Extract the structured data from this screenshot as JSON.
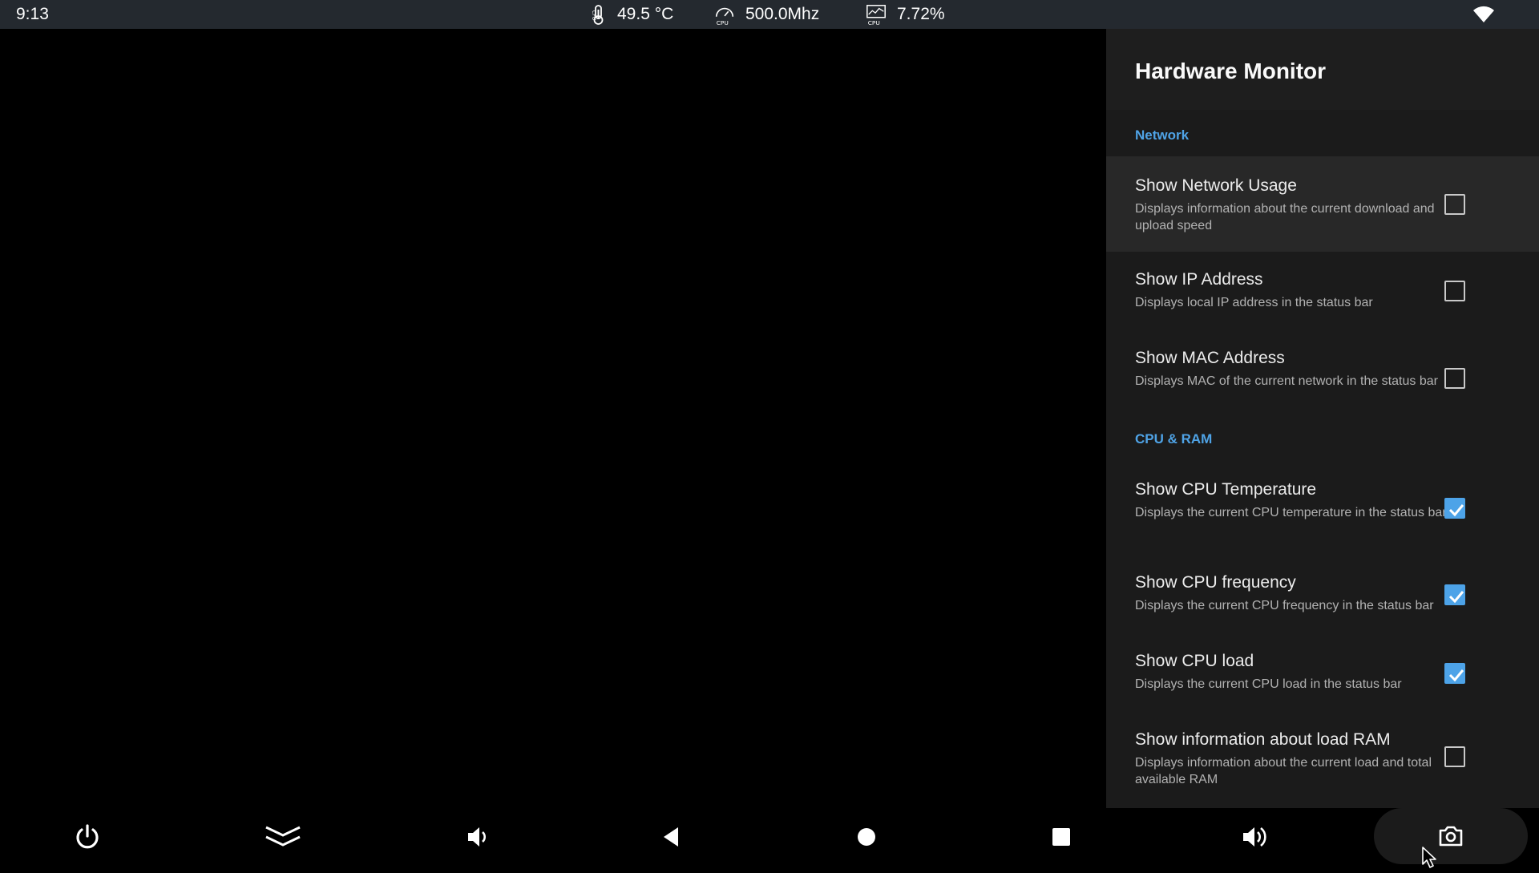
{
  "status_bar": {
    "time": "9:13",
    "cpu_temperature": "49.5 °C",
    "cpu_frequency": "500.0Mhz",
    "cpu_load": "7.72%",
    "icons": [
      "thermometer-icon",
      "cpu-speedometer-icon",
      "cpu-load-chart-icon",
      "wifi-icon"
    ],
    "icon_labels": {
      "cpu": "CPU"
    }
  },
  "panel": {
    "title": "Hardware Monitor",
    "sections": [
      {
        "title": "Network",
        "items": [
          {
            "title": "Show Network Usage",
            "summary": "Displays information about the current download and upload speed",
            "checked": false,
            "focused": true
          },
          {
            "title": "Show IP Address",
            "summary": "Displays local IP address in the status bar",
            "checked": false
          },
          {
            "title": "Show MAC Address",
            "summary": "Displays MAC of the current network in the status bar",
            "checked": false
          }
        ]
      },
      {
        "title": "CPU & RAM",
        "items": [
          {
            "title": "Show CPU Temperature",
            "summary": "Displays the current CPU temperature in the status bar",
            "checked": true
          },
          {
            "title": "Show CPU frequency",
            "summary": "Displays the current CPU frequency in the status bar",
            "checked": true
          },
          {
            "title": "Show CPU load",
            "summary": "Displays the current CPU load in the status bar",
            "checked": true
          },
          {
            "title": "Show information about load RAM",
            "summary": "Displays information about the current load and total available RAM",
            "checked": false
          }
        ]
      }
    ]
  },
  "nav_bar": {
    "buttons": [
      "power-icon",
      "collapse-chevrons-icon",
      "volume-down-icon",
      "back-icon",
      "home-icon",
      "recents-icon",
      "volume-up-icon",
      "camera-icon"
    ]
  },
  "colors": {
    "accent": "#4da3e8",
    "status_bar_bg": "#24292f",
    "panel_bg": "#1b1b1b"
  }
}
